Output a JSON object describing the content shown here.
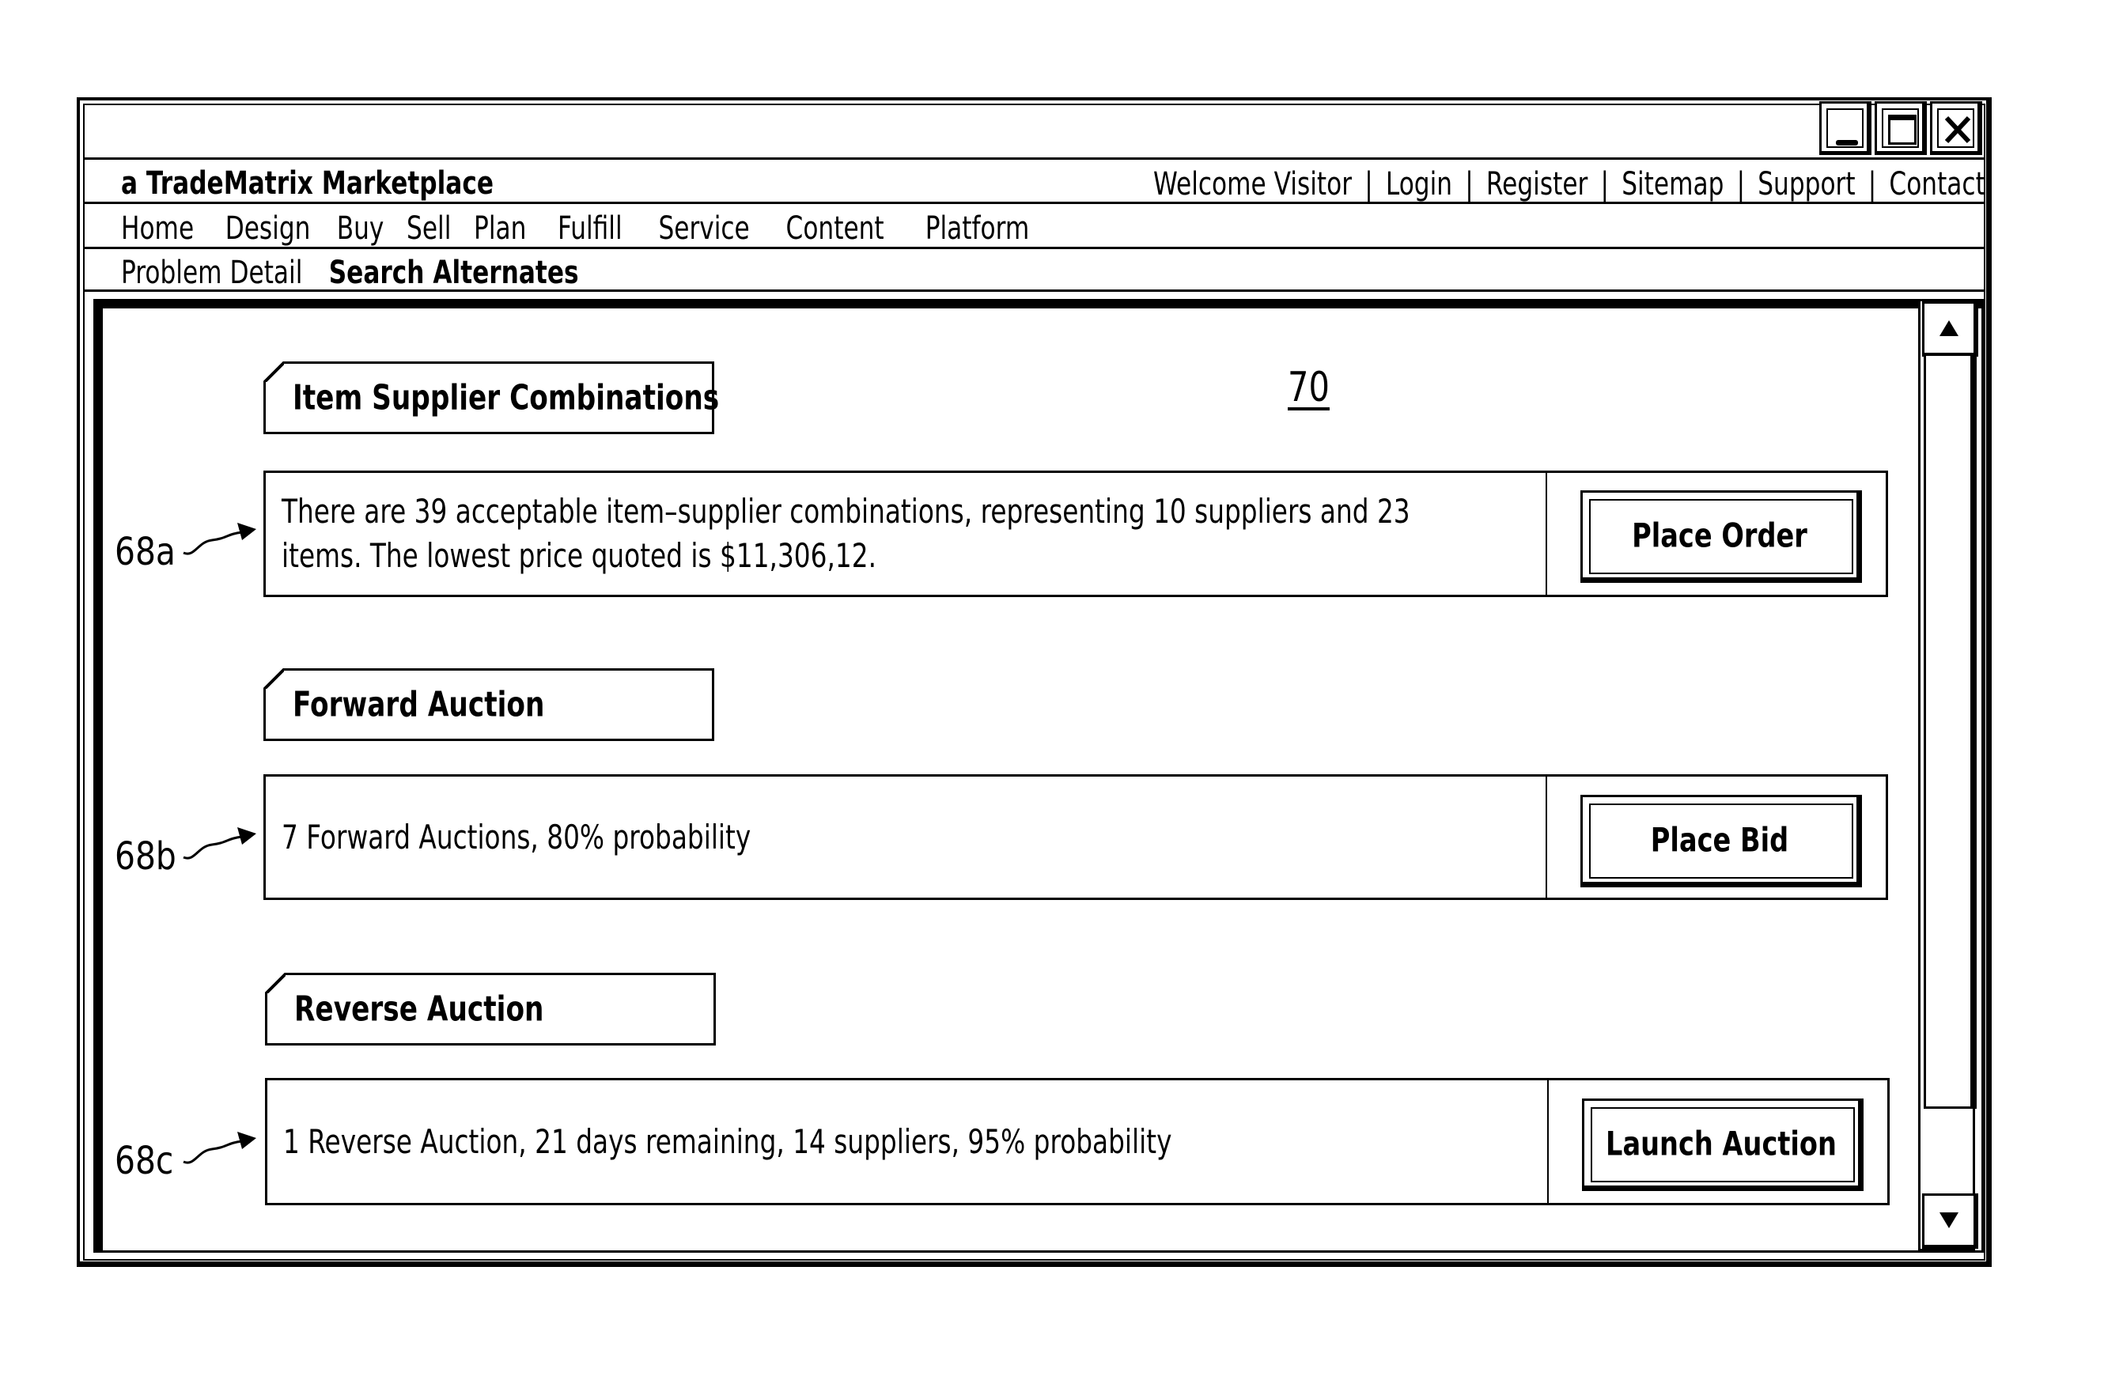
{
  "window": {
    "controls": {
      "minimize": "minimize",
      "maximize": "maximize",
      "close": "close"
    }
  },
  "header": {
    "brand": "a TradeMatrix Marketplace",
    "welcome": "Welcome Visitor",
    "links": [
      "Login",
      "Register",
      "Sitemap",
      "Support",
      "Contact"
    ],
    "separator": "|"
  },
  "nav": {
    "items": [
      "Home",
      "Design",
      "Buy",
      "Sell",
      "Plan",
      "Fulfill",
      "Service",
      "Content",
      "Platform"
    ]
  },
  "subnav": {
    "items": [
      {
        "label": "Problem Detail",
        "active": false
      },
      {
        "label": "Search Alternates",
        "active": true
      }
    ]
  },
  "figure_ref": "70",
  "sections": [
    {
      "title": "Item Supplier Combinations",
      "callout": "68a",
      "text_line1": "There are 39 acceptable item–supplier combinations, representing 10 suppliers and 23",
      "text_line2": "items. The lowest price quoted is $11,306,12.",
      "button": "Place Order"
    },
    {
      "title": "Forward Auction",
      "callout": "68b",
      "text_line1": "7 Forward Auctions, 80% probability",
      "text_line2": "",
      "button": "Place Bid"
    },
    {
      "title": "Reverse Auction",
      "callout": "68c",
      "text_line1": "1 Reverse Auction, 21 days remaining, 14 suppliers, 95% probability",
      "text_line2": "",
      "button": "Launch Auction"
    }
  ],
  "scrollbar": {
    "position_fraction": 0.0,
    "visible_fraction": 0.89,
    "up_icon": "arrow-up",
    "down_icon": "arrow-down"
  }
}
